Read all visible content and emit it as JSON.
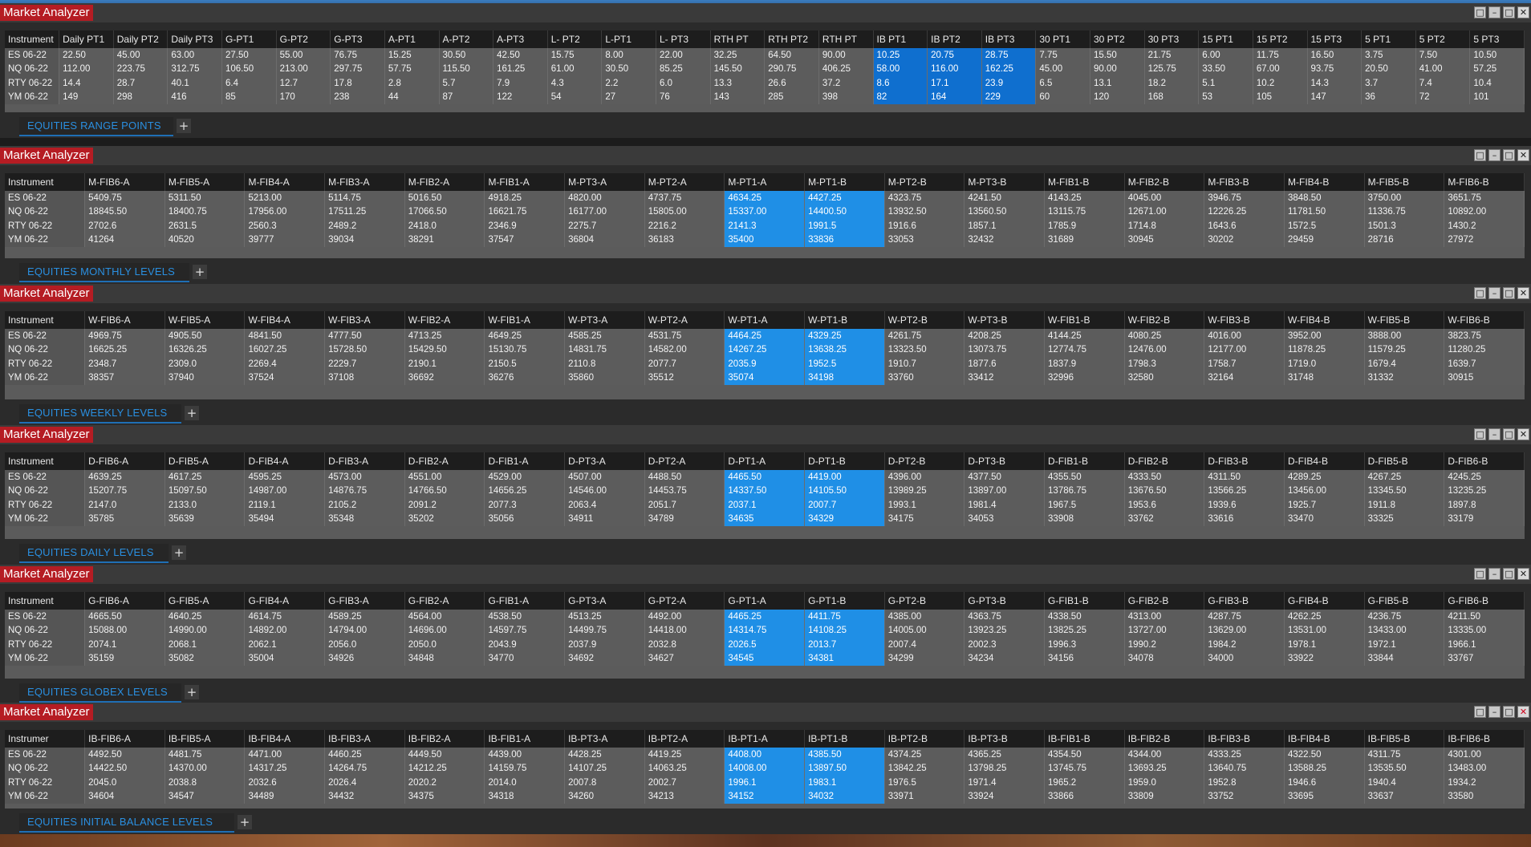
{
  "app_title": "Market Analyzer",
  "window_controls": [
    "restore-icon",
    "minimize-icon",
    "maximize-icon",
    "close-icon"
  ],
  "add_tab_label": "+",
  "colors": {
    "title_red": "#b51c23",
    "highlight_blue": "#1f8fe6",
    "tab_text": "#2a8fe0"
  },
  "panels": [
    {
      "tab_label": "EQUITIES RANGE POINTS",
      "columns": [
        "Instrument",
        "Daily PT1",
        "Daily PT2",
        "Daily PT3",
        "G-PT1",
        "G-PT2",
        "G-PT3",
        "A-PT1",
        "A-PT2",
        "A-PT3",
        "L- PT2",
        "L-PT1",
        "L- PT3",
        "RTH PT",
        "RTH PT2",
        "RTH PT",
        "IB PT1",
        "IB PT2",
        "IB PT3",
        "30 PT1",
        "30 PT2",
        "30 PT3",
        "15 PT1",
        "15 PT2",
        "15 PT3",
        "5 PT1",
        "5 PT2",
        "5 PT3"
      ],
      "highlight_cols": [
        16,
        17,
        18
      ],
      "rows": [
        [
          "ES 06-22",
          "22.50",
          "45.00",
          "63.00",
          "27.50",
          "55.00",
          "76.75",
          "15.25",
          "30.50",
          "42.50",
          "15.75",
          "8.00",
          "22.00",
          "32.25",
          "64.50",
          "90.00",
          "10.25",
          "20.75",
          "28.75",
          "7.75",
          "15.50",
          "21.75",
          "6.00",
          "11.75",
          "16.50",
          "3.75",
          "7.50",
          "10.50"
        ],
        [
          "NQ 06-22",
          "112.00",
          "223.75",
          "312.75",
          "106.50",
          "213.00",
          "297.75",
          "57.75",
          "115.50",
          "161.25",
          "61.00",
          "30.50",
          "85.25",
          "145.50",
          "290.75",
          "406.25",
          "58.00",
          "116.00",
          "162.25",
          "45.00",
          "90.00",
          "125.75",
          "33.50",
          "67.00",
          "93.75",
          "20.50",
          "41.00",
          "57.25"
        ],
        [
          "RTY 06-22",
          "14.4",
          "28.7",
          "40.1",
          "6.4",
          "12.7",
          "17.8",
          "2.8",
          "5.7",
          "7.9",
          "4.3",
          "2.2",
          "6.0",
          "13.3",
          "26.6",
          "37.2",
          "8.6",
          "17.1",
          "23.9",
          "6.5",
          "13.1",
          "18.2",
          "5.1",
          "10.2",
          "14.3",
          "3.7",
          "7.4",
          "10.4"
        ],
        [
          "YM 06-22",
          "149",
          "298",
          "416",
          "85",
          "170",
          "238",
          "44",
          "87",
          "122",
          "54",
          "27",
          "76",
          "143",
          "285",
          "398",
          "82",
          "164",
          "229",
          "60",
          "120",
          "168",
          "53",
          "105",
          "147",
          "36",
          "72",
          "101"
        ]
      ]
    },
    {
      "tab_label": "EQUITIES MONTHLY LEVELS",
      "columns": [
        "Instrument",
        "M-FIB6-A",
        "M-FIB5-A",
        "M-FIB4-A",
        "M-FIB3-A",
        "M-FIB2-A",
        "M-FIB1-A",
        "M-PT3-A",
        "M-PT2-A",
        "M-PT1-A",
        "M-PT1-B",
        "M-PT2-B",
        "M-PT3-B",
        "M-FIB1-B",
        "M-FIB2-B",
        "M-FIB3-B",
        "M-FIB4-B",
        "M-FIB5-B",
        "M-FIB6-B"
      ],
      "highlight_cols": [
        9,
        10
      ],
      "rows": [
        [
          "ES 06-22",
          "5409.75",
          "5311.50",
          "5213.00",
          "5114.75",
          "5016.50",
          "4918.25",
          "4820.00",
          "4737.75",
          "4634.25",
          "4427.25",
          "4323.75",
          "4241.50",
          "4143.25",
          "4045.00",
          "3946.75",
          "3848.50",
          "3750.00",
          "3651.75"
        ],
        [
          "NQ 06-22",
          "18845.50",
          "18400.75",
          "17956.00",
          "17511.25",
          "17066.50",
          "16621.75",
          "16177.00",
          "15805.00",
          "15337.00",
          "14400.50",
          "13932.50",
          "13560.50",
          "13115.75",
          "12671.00",
          "12226.25",
          "11781.50",
          "11336.75",
          "10892.00"
        ],
        [
          "RTY 06-22",
          "2702.6",
          "2631.5",
          "2560.3",
          "2489.2",
          "2418.0",
          "2346.9",
          "2275.7",
          "2216.2",
          "2141.3",
          "1991.5",
          "1916.6",
          "1857.1",
          "1785.9",
          "1714.8",
          "1643.6",
          "1572.5",
          "1501.3",
          "1430.2"
        ],
        [
          "YM 06-22",
          "41264",
          "40520",
          "39777",
          "39034",
          "38291",
          "37547",
          "36804",
          "36183",
          "35400",
          "33836",
          "33053",
          "32432",
          "31689",
          "30945",
          "30202",
          "29459",
          "28716",
          "27972"
        ]
      ]
    },
    {
      "tab_label": "EQUITIES WEEKLY LEVELS",
      "columns": [
        "Instrument",
        "W-FIB6-A",
        "W-FIB5-A",
        "W-FIB4-A",
        "W-FIB3-A",
        "W-FIB2-A",
        "W-FIB1-A",
        "W-PT3-A",
        "W-PT2-A",
        "W-PT1-A",
        "W-PT1-B",
        "W-PT2-B",
        "W-PT3-B",
        "W-FIB1-B",
        "W-FIB2-B",
        "W-FIB3-B",
        "W-FIB4-B",
        "W-FIB5-B",
        "W-FIB6-B"
      ],
      "highlight_cols": [
        9,
        10
      ],
      "rows": [
        [
          "ES 06-22",
          "4969.75",
          "4905.50",
          "4841.50",
          "4777.50",
          "4713.25",
          "4649.25",
          "4585.25",
          "4531.75",
          "4464.25",
          "4329.25",
          "4261.75",
          "4208.25",
          "4144.25",
          "4080.25",
          "4016.00",
          "3952.00",
          "3888.00",
          "3823.75"
        ],
        [
          "NQ 06-22",
          "16625.25",
          "16326.25",
          "16027.25",
          "15728.50",
          "15429.50",
          "15130.75",
          "14831.75",
          "14582.00",
          "14267.25",
          "13638.25",
          "13323.50",
          "13073.75",
          "12774.75",
          "12476.00",
          "12177.00",
          "11878.25",
          "11579.25",
          "11280.25"
        ],
        [
          "RTY 06-22",
          "2348.7",
          "2309.0",
          "2269.4",
          "2229.7",
          "2190.1",
          "2150.5",
          "2110.8",
          "2077.7",
          "2035.9",
          "1952.5",
          "1910.7",
          "1877.6",
          "1837.9",
          "1798.3",
          "1758.7",
          "1719.0",
          "1679.4",
          "1639.7"
        ],
        [
          "YM 06-22",
          "38357",
          "37940",
          "37524",
          "37108",
          "36692",
          "36276",
          "35860",
          "35512",
          "35074",
          "34198",
          "33760",
          "33412",
          "32996",
          "32580",
          "32164",
          "31748",
          "31332",
          "30915"
        ]
      ]
    },
    {
      "tab_label": "EQUITIES DAILY LEVELS",
      "columns": [
        "Instrument",
        "D-FIB6-A",
        "D-FIB5-A",
        "D-FIB4-A",
        "D-FIB3-A",
        "D-FIB2-A",
        "D-FIB1-A",
        "D-PT3-A",
        "D-PT2-A",
        "D-PT1-A",
        "D-PT1-B",
        "D-PT2-B",
        "D-PT3-B",
        "D-FIB1-B",
        "D-FIB2-B",
        "D-FIB3-B",
        "D-FIB4-B",
        "D-FIB5-B",
        "D-FIB6-B"
      ],
      "highlight_cols": [
        9,
        10
      ],
      "rows": [
        [
          "ES 06-22",
          "4639.25",
          "4617.25",
          "4595.25",
          "4573.00",
          "4551.00",
          "4529.00",
          "4507.00",
          "4488.50",
          "4465.50",
          "4419.00",
          "4396.00",
          "4377.50",
          "4355.50",
          "4333.50",
          "4311.50",
          "4289.25",
          "4267.25",
          "4245.25"
        ],
        [
          "NQ 06-22",
          "15207.75",
          "15097.50",
          "14987.00",
          "14876.75",
          "14766.50",
          "14656.25",
          "14546.00",
          "14453.75",
          "14337.50",
          "14105.50",
          "13989.25",
          "13897.00",
          "13786.75",
          "13676.50",
          "13566.25",
          "13456.00",
          "13345.50",
          "13235.25"
        ],
        [
          "RTY 06-22",
          "2147.0",
          "2133.0",
          "2119.1",
          "2105.2",
          "2091.2",
          "2077.3",
          "2063.4",
          "2051.7",
          "2037.1",
          "2007.7",
          "1993.1",
          "1981.4",
          "1967.5",
          "1953.6",
          "1939.6",
          "1925.7",
          "1911.8",
          "1897.8"
        ],
        [
          "YM 06-22",
          "35785",
          "35639",
          "35494",
          "35348",
          "35202",
          "35056",
          "34911",
          "34789",
          "34635",
          "34329",
          "34175",
          "34053",
          "33908",
          "33762",
          "33616",
          "33470",
          "33325",
          "33179"
        ]
      ]
    },
    {
      "tab_label": "EQUITIES GLOBEX LEVELS",
      "columns": [
        "Instrument",
        "G-FIB6-A",
        "G-FIB5-A",
        "G-FIB4-A",
        "G-FIB3-A",
        "G-FIB2-A",
        "G-FIB1-A",
        "G-PT3-A",
        "G-PT2-A",
        "G-PT1-A",
        "G-PT1-B",
        "G-PT2-B",
        "G-PT3-B",
        "G-FIB1-B",
        "G-FIB2-B",
        "G-FIB3-B",
        "G-FIB4-B",
        "G-FIB5-B",
        "G-FIB6-B"
      ],
      "highlight_cols": [
        9,
        10
      ],
      "rows": [
        [
          "ES 06-22",
          "4665.50",
          "4640.25",
          "4614.75",
          "4589.25",
          "4564.00",
          "4538.50",
          "4513.25",
          "4492.00",
          "4465.25",
          "4411.75",
          "4385.00",
          "4363.75",
          "4338.50",
          "4313.00",
          "4287.75",
          "4262.25",
          "4236.75",
          "4211.50"
        ],
        [
          "NQ 06-22",
          "15088.00",
          "14990.00",
          "14892.00",
          "14794.00",
          "14696.00",
          "14597.75",
          "14499.75",
          "14418.00",
          "14314.75",
          "14108.25",
          "14005.00",
          "13923.25",
          "13825.25",
          "13727.00",
          "13629.00",
          "13531.00",
          "13433.00",
          "13335.00"
        ],
        [
          "RTY 06-22",
          "2074.1",
          "2068.1",
          "2062.1",
          "2056.0",
          "2050.0",
          "2043.9",
          "2037.9",
          "2032.8",
          "2026.5",
          "2013.7",
          "2007.4",
          "2002.3",
          "1996.3",
          "1990.2",
          "1984.2",
          "1978.1",
          "1972.1",
          "1966.1"
        ],
        [
          "YM 06-22",
          "35159",
          "35082",
          "35004",
          "34926",
          "34848",
          "34770",
          "34692",
          "34627",
          "34545",
          "34381",
          "34299",
          "34234",
          "34156",
          "34078",
          "34000",
          "33922",
          "33844",
          "33767"
        ]
      ]
    },
    {
      "tab_label": "EQUITIES INITIAL BALANCE LEVELS",
      "columns": [
        "Instrumer",
        "IB-FIB6-A",
        "IB-FIB5-A",
        "IB-FIB4-A",
        "IB-FIB3-A",
        "IB-FIB2-A",
        "IB-FIB1-A",
        "IB-PT3-A",
        "IB-PT2-A",
        "IB-PT1-A",
        "IB-PT1-B",
        "IB-PT2-B",
        "IB-PT3-B",
        "IB-FIB1-B",
        "IB-FIB2-B",
        "IB-FIB3-B",
        "IB-FIB4-B",
        "IB-FIB5-B",
        "IB-FIB6-B"
      ],
      "highlight_cols": [
        9,
        10
      ],
      "rows": [
        [
          "ES 06-22",
          "4492.50",
          "4481.75",
          "4471.00",
          "4460.25",
          "4449.50",
          "4439.00",
          "4428.25",
          "4419.25",
          "4408.00",
          "4385.50",
          "4374.25",
          "4365.25",
          "4354.50",
          "4344.00",
          "4333.25",
          "4322.50",
          "4311.75",
          "4301.00"
        ],
        [
          "NQ 06-22",
          "14422.50",
          "14370.00",
          "14317.25",
          "14264.75",
          "14212.25",
          "14159.75",
          "14107.25",
          "14063.25",
          "14008.00",
          "13897.50",
          "13842.25",
          "13798.25",
          "13745.75",
          "13693.25",
          "13640.75",
          "13588.25",
          "13535.50",
          "13483.00"
        ],
        [
          "RTY 06-22",
          "2045.0",
          "2038.8",
          "2032.6",
          "2026.4",
          "2020.2",
          "2014.0",
          "2007.8",
          "2002.7",
          "1996.1",
          "1983.1",
          "1976.5",
          "1971.4",
          "1965.2",
          "1959.0",
          "1952.8",
          "1946.6",
          "1940.4",
          "1934.2"
        ],
        [
          "YM 06-22",
          "34604",
          "34547",
          "34489",
          "34432",
          "34375",
          "34318",
          "34260",
          "34213",
          "34152",
          "34032",
          "33971",
          "33924",
          "33866",
          "33809",
          "33752",
          "33695",
          "33637",
          "33580"
        ]
      ]
    }
  ]
}
